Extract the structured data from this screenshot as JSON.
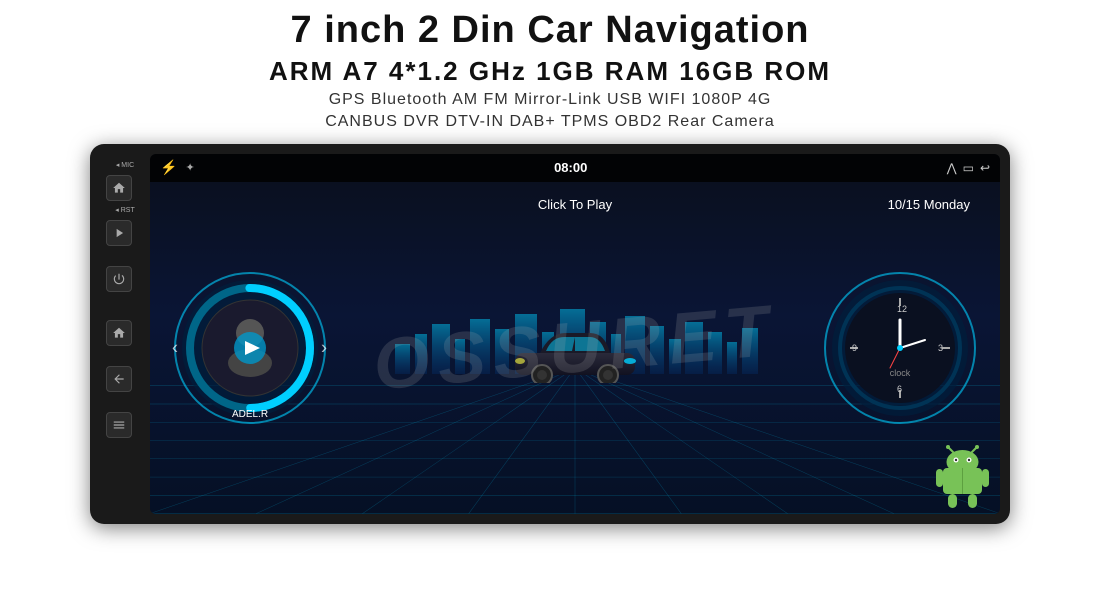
{
  "header": {
    "title": "7 inch 2 Din Car Navigation",
    "specs": "ARM A7 4*1.2 GHz    1GB RAM    16GB ROM",
    "features_line1": "GPS  Bluetooth  AM  FM  Mirror-Link  USB  WIFI  1080P  4G",
    "features_line2": "CANBUS   DVR   DTV-IN   DAB+   TPMS   OBD2   Rear Camera"
  },
  "device": {
    "screen": {
      "topbar": {
        "bluetooth_icon": "bluetooth",
        "time": "08:00",
        "signal_icon": "signal",
        "window_icon": "window",
        "back_icon": "back"
      },
      "click_to_play": "Click To Play",
      "date": "10/15 Monday",
      "music": {
        "artist": "ADEL.R",
        "play_icon": "play"
      },
      "clock_label": "clock"
    },
    "left_panel": {
      "mic_label": "MIC",
      "rst_label": "RST",
      "buttons": [
        "home",
        "power",
        "back",
        "home2",
        "back2"
      ]
    }
  },
  "watermark": "OSSURET",
  "colors": {
    "accent_cyan": "#00cfff",
    "bg_dark": "#0a0f1a",
    "device_black": "#1a1a1a"
  }
}
